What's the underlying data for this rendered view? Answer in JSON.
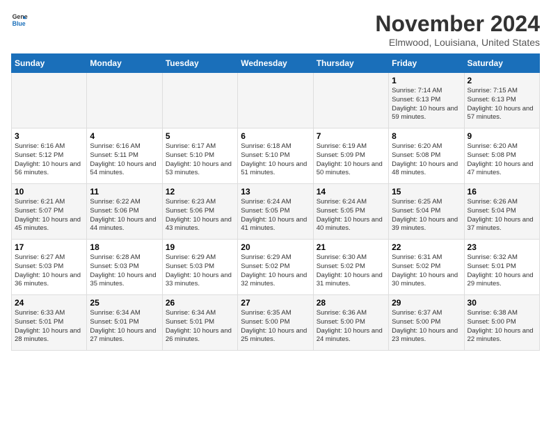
{
  "logo": {
    "line1": "General",
    "line2": "Blue"
  },
  "title": "November 2024",
  "location": "Elmwood, Louisiana, United States",
  "weekdays": [
    "Sunday",
    "Monday",
    "Tuesday",
    "Wednesday",
    "Thursday",
    "Friday",
    "Saturday"
  ],
  "weeks": [
    [
      {
        "day": "",
        "text": ""
      },
      {
        "day": "",
        "text": ""
      },
      {
        "day": "",
        "text": ""
      },
      {
        "day": "",
        "text": ""
      },
      {
        "day": "",
        "text": ""
      },
      {
        "day": "1",
        "text": "Sunrise: 7:14 AM\nSunset: 6:13 PM\nDaylight: 10 hours and 59 minutes."
      },
      {
        "day": "2",
        "text": "Sunrise: 7:15 AM\nSunset: 6:13 PM\nDaylight: 10 hours and 57 minutes."
      }
    ],
    [
      {
        "day": "3",
        "text": "Sunrise: 6:16 AM\nSunset: 5:12 PM\nDaylight: 10 hours and 56 minutes."
      },
      {
        "day": "4",
        "text": "Sunrise: 6:16 AM\nSunset: 5:11 PM\nDaylight: 10 hours and 54 minutes."
      },
      {
        "day": "5",
        "text": "Sunrise: 6:17 AM\nSunset: 5:10 PM\nDaylight: 10 hours and 53 minutes."
      },
      {
        "day": "6",
        "text": "Sunrise: 6:18 AM\nSunset: 5:10 PM\nDaylight: 10 hours and 51 minutes."
      },
      {
        "day": "7",
        "text": "Sunrise: 6:19 AM\nSunset: 5:09 PM\nDaylight: 10 hours and 50 minutes."
      },
      {
        "day": "8",
        "text": "Sunrise: 6:20 AM\nSunset: 5:08 PM\nDaylight: 10 hours and 48 minutes."
      },
      {
        "day": "9",
        "text": "Sunrise: 6:20 AM\nSunset: 5:08 PM\nDaylight: 10 hours and 47 minutes."
      }
    ],
    [
      {
        "day": "10",
        "text": "Sunrise: 6:21 AM\nSunset: 5:07 PM\nDaylight: 10 hours and 45 minutes."
      },
      {
        "day": "11",
        "text": "Sunrise: 6:22 AM\nSunset: 5:06 PM\nDaylight: 10 hours and 44 minutes."
      },
      {
        "day": "12",
        "text": "Sunrise: 6:23 AM\nSunset: 5:06 PM\nDaylight: 10 hours and 43 minutes."
      },
      {
        "day": "13",
        "text": "Sunrise: 6:24 AM\nSunset: 5:05 PM\nDaylight: 10 hours and 41 minutes."
      },
      {
        "day": "14",
        "text": "Sunrise: 6:24 AM\nSunset: 5:05 PM\nDaylight: 10 hours and 40 minutes."
      },
      {
        "day": "15",
        "text": "Sunrise: 6:25 AM\nSunset: 5:04 PM\nDaylight: 10 hours and 39 minutes."
      },
      {
        "day": "16",
        "text": "Sunrise: 6:26 AM\nSunset: 5:04 PM\nDaylight: 10 hours and 37 minutes."
      }
    ],
    [
      {
        "day": "17",
        "text": "Sunrise: 6:27 AM\nSunset: 5:03 PM\nDaylight: 10 hours and 36 minutes."
      },
      {
        "day": "18",
        "text": "Sunrise: 6:28 AM\nSunset: 5:03 PM\nDaylight: 10 hours and 35 minutes."
      },
      {
        "day": "19",
        "text": "Sunrise: 6:29 AM\nSunset: 5:03 PM\nDaylight: 10 hours and 33 minutes."
      },
      {
        "day": "20",
        "text": "Sunrise: 6:29 AM\nSunset: 5:02 PM\nDaylight: 10 hours and 32 minutes."
      },
      {
        "day": "21",
        "text": "Sunrise: 6:30 AM\nSunset: 5:02 PM\nDaylight: 10 hours and 31 minutes."
      },
      {
        "day": "22",
        "text": "Sunrise: 6:31 AM\nSunset: 5:02 PM\nDaylight: 10 hours and 30 minutes."
      },
      {
        "day": "23",
        "text": "Sunrise: 6:32 AM\nSunset: 5:01 PM\nDaylight: 10 hours and 29 minutes."
      }
    ],
    [
      {
        "day": "24",
        "text": "Sunrise: 6:33 AM\nSunset: 5:01 PM\nDaylight: 10 hours and 28 minutes."
      },
      {
        "day": "25",
        "text": "Sunrise: 6:34 AM\nSunset: 5:01 PM\nDaylight: 10 hours and 27 minutes."
      },
      {
        "day": "26",
        "text": "Sunrise: 6:34 AM\nSunset: 5:01 PM\nDaylight: 10 hours and 26 minutes."
      },
      {
        "day": "27",
        "text": "Sunrise: 6:35 AM\nSunset: 5:00 PM\nDaylight: 10 hours and 25 minutes."
      },
      {
        "day": "28",
        "text": "Sunrise: 6:36 AM\nSunset: 5:00 PM\nDaylight: 10 hours and 24 minutes."
      },
      {
        "day": "29",
        "text": "Sunrise: 6:37 AM\nSunset: 5:00 PM\nDaylight: 10 hours and 23 minutes."
      },
      {
        "day": "30",
        "text": "Sunrise: 6:38 AM\nSunset: 5:00 PM\nDaylight: 10 hours and 22 minutes."
      }
    ]
  ]
}
